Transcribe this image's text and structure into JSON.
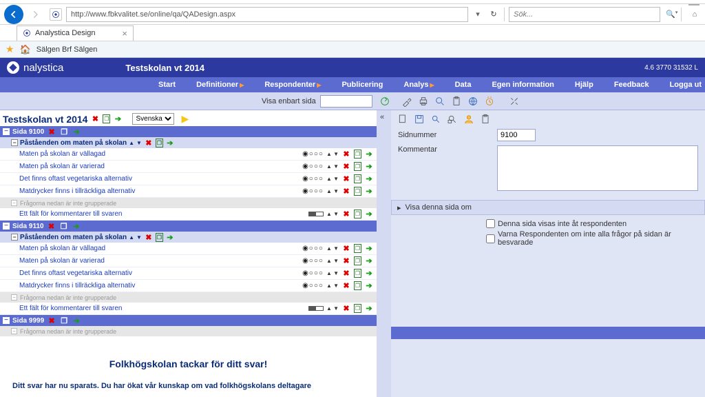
{
  "browser": {
    "url": "http://www.fbkvalitet.se/online/qa/QADesign.aspx",
    "search_placeholder": "Sök...",
    "tab_title": "Analystica Design",
    "favbar_item": "Sälgen  Brf Sälgen"
  },
  "app": {
    "brand": "nalystica",
    "project": "Testskolan vt 2014",
    "version": "4.6 3770 31532 L"
  },
  "menu": {
    "start": "Start",
    "definitioner": "Definitioner",
    "respondenter": "Respondenter",
    "publicering": "Publicering",
    "analys": "Analys",
    "data": "Data",
    "egen": "Egen information",
    "hjalp": "Hjälp",
    "feedback": "Feedback",
    "logga_ut": "Logga ut"
  },
  "filter": {
    "visa_enbart": "Visa enbart sida"
  },
  "left": {
    "title": "Testskolan vt 2014",
    "lang": "Svenska",
    "pages": [
      {
        "label": "Sida 9100",
        "section": "Påståenden om maten på skolan",
        "questions": [
          "Maten på skolan är vällagad",
          "Maten på skolan är varierad",
          "Det finns oftast vegetariska alternativ",
          "Matdrycker finns i tillräckliga alternativ"
        ],
        "gray": "Frågorna nedan är inte grupperade",
        "comment_field": "Ett fält för kommentarer till svaren"
      },
      {
        "label": "Sida 9110",
        "section": "Påståenden om maten på skolan",
        "questions": [
          "Maten på skolan är vällagad",
          "Maten på skolan är varierad",
          "Det finns oftast vegetariska alternativ",
          "Matdrycker finns i tillräckliga alternativ"
        ],
        "gray": "Frågorna nedan är inte grupperade",
        "comment_field": "Ett fält för kommentarer till svaren"
      },
      {
        "label": "Sida 9999",
        "gray": "Frågorna nedan är inte grupperade"
      }
    ],
    "thanks": "Folkhögskolan tackar för ditt svar!",
    "saved": "Ditt svar har nu sparats. Du har ökat vår kunskap om vad folkhögskolans deltagare"
  },
  "right": {
    "sidnummer_label": "Sidnummer",
    "sidnummer_value": "9100",
    "kommentar_label": "Kommentar",
    "accordion": "Visa denna sida om",
    "chk1": "Denna sida visas inte åt respondenten",
    "chk2": "Varna Respondenten om inte alla frågor på sidan är besvarade"
  }
}
